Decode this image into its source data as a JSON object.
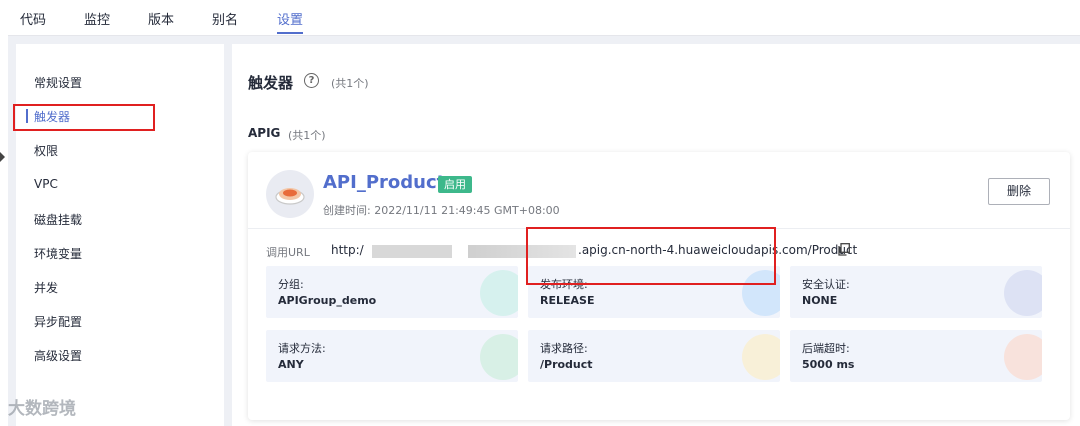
{
  "tabs": [
    "代码",
    "监控",
    "版本",
    "别名",
    "设置"
  ],
  "sidebar": [
    "常规设置",
    "触发器",
    "权限",
    "VPC",
    "磁盘挂载",
    "环境变量",
    "并发",
    "异步配置",
    "高级设置"
  ],
  "section": {
    "title": "触发器",
    "count": "(共1个)"
  },
  "apig": {
    "title": "APIG",
    "count": "(共1个)"
  },
  "trigger": {
    "name": "API_Product",
    "status": "启用",
    "created": "创建时间: 2022/11/11 21:49:45 GMT+08:00",
    "delete_label": "删除",
    "url_label": "调用URL",
    "url_prefix": "http:/",
    "url_suffix": ".apig.cn-north-4.huaweicloudapis.com/Product"
  },
  "tiles": [
    {
      "label": "分组:",
      "value": "APIGroup_demo",
      "icon": "group-icon",
      "color": "#d6f1ee"
    },
    {
      "label": "发布环境:",
      "value": "RELEASE",
      "icon": "code-icon",
      "color": "#d2e6fb"
    },
    {
      "label": "安全认证:",
      "value": "NONE",
      "icon": "shield-icon",
      "color": "#dde2f4"
    },
    {
      "label": "请求方法:",
      "value": "ANY",
      "icon": "method-icon",
      "color": "#d8f0e6"
    },
    {
      "label": "请求路径:",
      "value": "/Product",
      "icon": "path-icon",
      "color": "#f8f0d8"
    },
    {
      "label": "后端超时:",
      "value": "5000 ms",
      "icon": "clock-icon",
      "color": "#f8e2dc"
    }
  ],
  "watermark": "大数跨境",
  "colors": {
    "accent": "#526ecc",
    "status_green": "#3db88b",
    "highlight_red": "#e02020"
  }
}
